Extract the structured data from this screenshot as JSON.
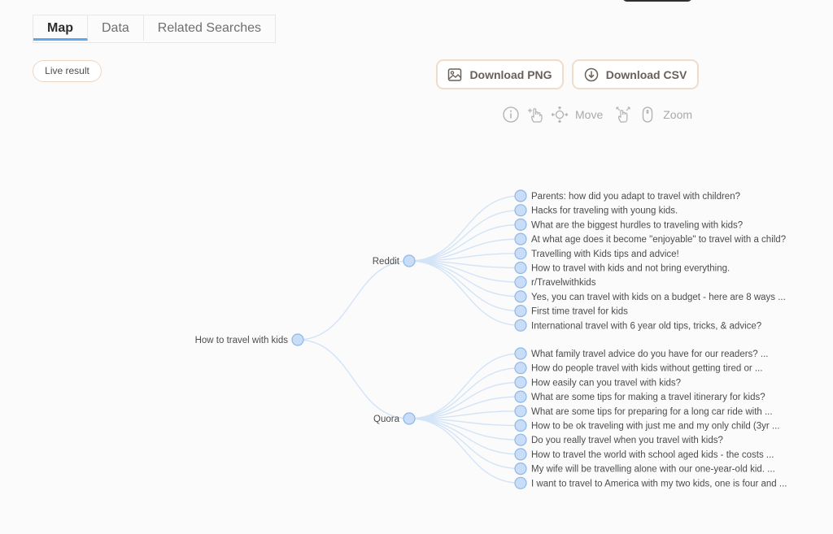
{
  "tabs": [
    "Map",
    "Data",
    "Related Searches"
  ],
  "live_result": "Live result",
  "buttons": {
    "download_png": "Download PNG",
    "download_csv": "Download CSV"
  },
  "hints": {
    "move": "Move",
    "zoom": "Zoom"
  },
  "icons": {
    "download_png": "image-icon",
    "download_csv": "download-circle-icon",
    "info": "info-icon",
    "drag": "drag-hand-icon",
    "move": "move-arrows-icon",
    "pinch": "pinch-hand-icon",
    "zoom": "mouse-scroll-icon"
  },
  "colors": {
    "accent": "#5fa8ee",
    "node": "#c9ddf7",
    "edge": "#d3e4f7",
    "button_border": "#f0dccb"
  },
  "tree": {
    "root": "How to travel with kids",
    "branches": [
      {
        "name": "Reddit",
        "items": [
          "Parents: how did you adapt to travel with children?",
          "Hacks for traveling with young kids.",
          "What are the biggest hurdles to traveling with kids?",
          "At what age does it become \"enjoyable\" to travel with a child?",
          "Travelling with Kids tips and advice!",
          "How to travel with kids and not bring everything.",
          "r/Travelwithkids",
          "Yes, you can travel with kids on a budget - here are 8 ways ...",
          "First time travel for kids",
          "International travel with 6 year old tips, tricks, & advice?"
        ]
      },
      {
        "name": "Quora",
        "items": [
          "What family travel advice do you have for our readers? ...",
          "How do people travel with kids without getting tired or ...",
          "How easily can you travel with kids?",
          "What are some tips for making a travel itinerary for kids?",
          "What are some tips for preparing for a long car ride with ...",
          "How to be ok traveling with just me and my only child (3yr ...",
          "Do you really travel when you travel with kids?",
          "How to travel the world with school aged kids - the costs ...",
          "My wife will be travelling alone with our one-year-old kid. ...",
          "I want to travel to America with my two kids, one is four and ..."
        ]
      }
    ]
  }
}
